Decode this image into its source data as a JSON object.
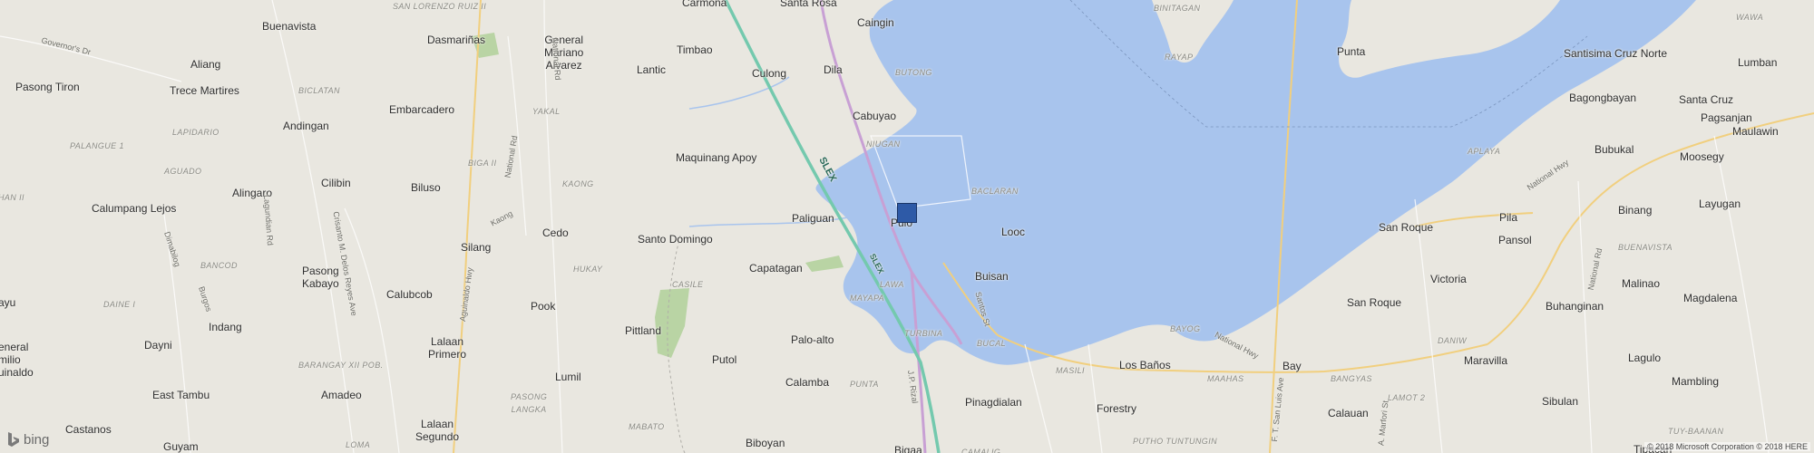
{
  "map": {
    "attribution": "© 2018 Microsoft Corporation © 2018 HERE",
    "logo_text": "bing",
    "colors": {
      "land": "#e9e7e0",
      "water": "#a8c4ed",
      "highway": "#74c9ae",
      "major_road": "#c8a0d4",
      "secondary_road": "#f1cf7e",
      "park": "#b9d4a4",
      "marker": "#2e5aa7"
    },
    "marker_icon": "square-pushpin",
    "places": {
      "carmona": "Carmona",
      "santa_rosa": "Santa Rosa",
      "caingin": "Caingin",
      "buenavista": "Buenavista",
      "dasmarinas": "Dasmariñas",
      "general_mariano_alvarez": "General\nMariano\nAlvarez",
      "timbao": "Timbao",
      "lantic": "Lantic",
      "culong": "Culong",
      "dila": "Dila",
      "cabuyao": "Cabuyao",
      "aliang": "Aliang",
      "trece_martires": "Trece Martires",
      "pasong_tiron": "Pasong Tiron",
      "andingan": "Andingan",
      "embarcadero": "Embarcadero",
      "maquinang_apoy": "Maquinang Apoy",
      "alingaro": "Alingaro",
      "cilibin": "Cilibin",
      "biluso": "Biluso",
      "calumpang_lejos": "Calumpang Lejos",
      "paliguan": "Paliguan",
      "pulo": "Pulo",
      "looc": "Looc",
      "cedo": "Cedo",
      "silang": "Silang",
      "santo_domingo": "Santo Domingo",
      "capatagan": "Capatagan",
      "buisan": "Buisan",
      "pasong_kabayo": "Pasong\nKabayo",
      "calubcob": "Calubcob",
      "pook": "Pook",
      "ayu": "ayu",
      "indang": "Indang",
      "pittland": "Pittland",
      "palo_alto": "Palo-alto",
      "dayni": "Dayni",
      "lalaan_primero": "Lalaan\nPrimero",
      "general_emilio_aguinaldo": "eneral\nmilio\nuinaldo",
      "putol": "Putol",
      "calamba": "Calamba",
      "lumil": "Lumil",
      "east_tambu": "East Tambu",
      "amadeo": "Amadeo",
      "pinagdialan": "Pinagdialan",
      "forestry": "Forestry",
      "los_banos": "Los Baños",
      "bay": "Bay",
      "calauan": "Calauan",
      "castanos": "Castanos",
      "lalaan_segundo": "Lalaan\nSegundo",
      "guyam": "Guyam",
      "biboyan": "Biboyan",
      "bigaa": "Bigaa",
      "punta_island": "Punta",
      "santisima_cruz_norte": "Santisima Cruz Norte",
      "lumban": "Lumban",
      "santa_cruz": "Santa Cruz",
      "bagongbayan": "Bagongbayan",
      "bubukal": "Bubukal",
      "pagsanjan": "Pagsanjan",
      "maulawin": "Maulawin",
      "moosegy": "Moosegy",
      "pila": "Pila",
      "pansol": "Pansol",
      "binang": "Binang",
      "layugan": "Layugan",
      "san_roque_1": "San Roque",
      "victoria": "Victoria",
      "malinao": "Malinao",
      "magdalena": "Magdalena",
      "san_roque_2": "San Roque",
      "buhanginan": "Buhanginan",
      "maravilla": "Maravilla",
      "lagulo": "Lagulo",
      "sibulan": "Sibulan",
      "mambling": "Mambling",
      "tipacan": "Tipacan"
    },
    "districts": {
      "san_lorenzo_ruiz_ii": "SAN LORENZO RUIZ II",
      "butong": "BUTONG",
      "biclatan": "BICLATAN",
      "lapidario": "LAPIDARIO",
      "yakal": "YAKAL",
      "palangue_1": "PALANGUE 1",
      "niugan": "NIUGAN",
      "aguado": "AGUADO",
      "biga_ii": "BIGA II",
      "kaong": "KAONG",
      "han_ii": "HAN II",
      "baclaran": "BACLARAN",
      "bancod": "BANCOD",
      "hukay": "HUKAY",
      "casile": "CASILE",
      "lawa": "LAWA",
      "mayapa": "MAYAPA",
      "daine_i": "DAINE I",
      "turbina": "TURBINA",
      "bucal": "BUCAL",
      "barangay_xii_pob": "BARANGAY XII POB.",
      "masili": "MASILI",
      "maahas": "MAAHAS",
      "punta_d": "PUNTA",
      "bayog": "BAYOG",
      "bangyas": "BANGYAS",
      "pasong_langka": "PASONG\nLANGKA",
      "loma": "LOMA",
      "mabato": "MABATO",
      "putho_tuntungin": "PUTHO TUNTUNGIN",
      "camalig": "CAMALIG",
      "lamot_2": "LAMOT 2",
      "daniw": "DANIW",
      "aplaya": "APLAYA",
      "buenavista_d": "BUENAVISTA",
      "tuy_baanan": "TUY-BAANAN",
      "wawa": "WAWA",
      "binitagan": "BINITAGAN",
      "rayap": "RAYAP"
    },
    "roads": {
      "slex_1": "SLEX",
      "slex_2": "SLEX",
      "governors_dr": "Governor's Dr",
      "national_rd_1": "National Rd",
      "national_rd_2": "National Rd",
      "national_rd_3": "National Rd",
      "national_hwy_1": "National Hwy",
      "national_hwy_2": "National Hwy",
      "kaong_rd": "Kaong",
      "lagundian_rd": "Lagundian Rd",
      "crisanto_reyes_ave": "Crisanto M. Delos Reyes Ave",
      "aguinaldo_hwy": "Aguinaldo Hwy",
      "dimabilog": "Dimabilog",
      "burgos": "Burgos",
      "jp_rizal": "J.P. Rizal",
      "santos_st": "Santos St",
      "ff_san_luis_ave": "F. T. San Luis Ave",
      "a_marfori_st": "A. Marfori St"
    }
  }
}
